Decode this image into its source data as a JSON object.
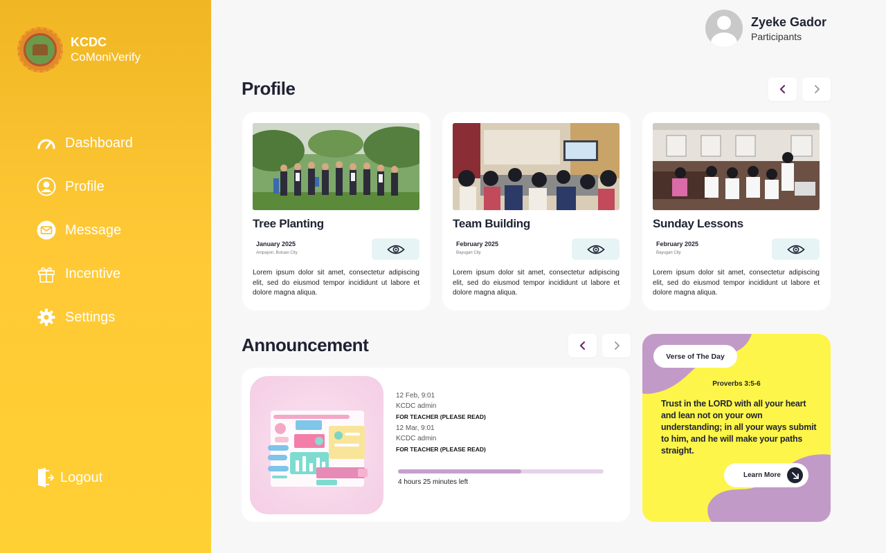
{
  "brand": {
    "name": "KCDC",
    "subtitle": "CoMoniVerify"
  },
  "nav": [
    {
      "label": "Dashboard",
      "icon": "gauge-icon"
    },
    {
      "label": "Profile",
      "icon": "user-icon"
    },
    {
      "label": "Message",
      "icon": "envelope-icon"
    },
    {
      "label": "Incentive",
      "icon": "gift-icon"
    },
    {
      "label": "Settings",
      "icon": "gear-icon"
    }
  ],
  "logout": {
    "label": "Logout",
    "icon": "logout-door-icon"
  },
  "user": {
    "name": "Zyeke Gador",
    "role": "Participants"
  },
  "profile": {
    "heading": "Profile",
    "cards": [
      {
        "title": "Tree Planting",
        "date": "January 2025",
        "location": "Ampayon, Butuan City",
        "description": "Lorem ipsum dolor sit amet, consectetur adipiscing elit, sed do eiusmod tempor incididunt ut labore et dolore magna aliqua."
      },
      {
        "title": "Team Building",
        "date": "February 2025",
        "location": "Bayugan City",
        "description": "Lorem ipsum dolor sit amet, consectetur adipiscing elit, sed do eiusmod tempor incididunt ut labore et dolore magna aliqua."
      },
      {
        "title": "Sunday Lessons",
        "date": "February 2025",
        "location": "Bayugan City",
        "description": "Lorem ipsum dolor sit amet, consectetur adipiscing elit, sed do eiusmod tempor incididunt ut labore et dolore magna aliqua."
      }
    ]
  },
  "announcement": {
    "heading": "Announcement",
    "items": [
      {
        "time": "12 Feb, 9:01",
        "author": "KCDC admin",
        "subject": "FOR TEACHER (PLEASE READ)"
      },
      {
        "time": "12 Mar, 9:01",
        "author": "KCDC admin",
        "subject": "FOR TEACHER (PLEASE READ)"
      }
    ],
    "progress_fraction": 0.6,
    "time_left": "4 hours 25 minutes left"
  },
  "verse": {
    "tag": "Verse of The Day",
    "reference": "Proverbs 3:5-6",
    "text": "Trust in the LORD with all your heart and lean not on your own understanding; in all your ways submit to him, and he will make your paths straight.",
    "button": "Learn More"
  },
  "colors": {
    "sidebar_top": "#f0b624",
    "sidebar_bottom": "#ffd033",
    "accent_purple": "#6b2d6b",
    "verse_bg": "#fdf54a",
    "verse_blob": "#c29ac8"
  }
}
